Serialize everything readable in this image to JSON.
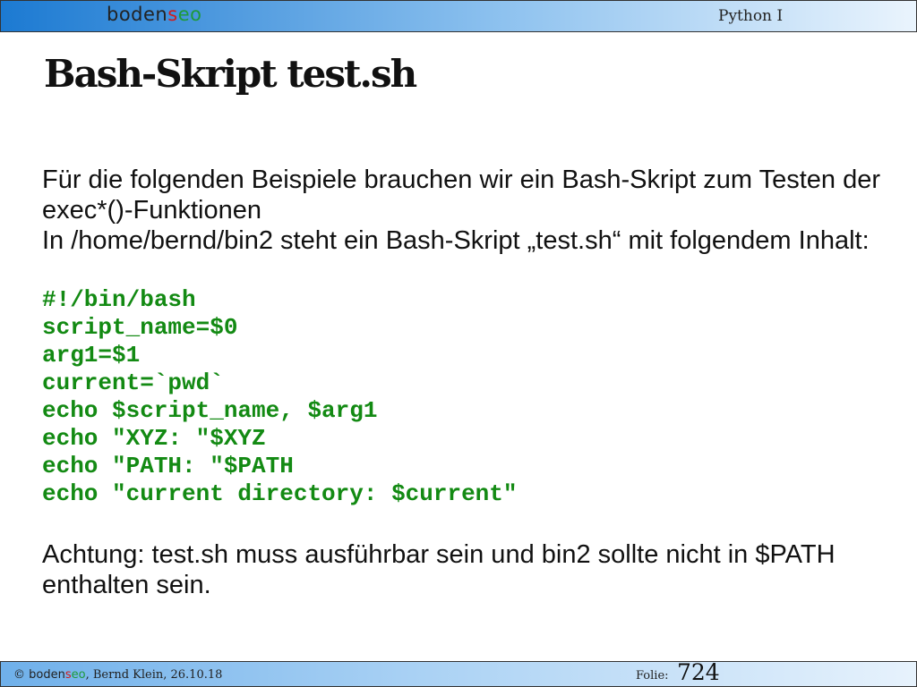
{
  "header": {
    "logo": {
      "part1": "boden",
      "part2": "s",
      "part3": "e",
      "part4": "o"
    },
    "course": "Python I"
  },
  "slide": {
    "title": "Bash-Skript test.sh",
    "intro_paragraphs": [
      "Für die folgenden Beispiele brauchen wir ein Bash-Skript zum Testen der exec*()-Funktionen",
      "In /home/bernd/bin2 steht ein Bash-Skript „test.sh“ mit folgendem Inhalt:"
    ],
    "code_lines": [
      "#!/bin/bash",
      "script_name=$0",
      "arg1=$1",
      "current=`pwd`",
      "echo $script_name, $arg1",
      "echo \"XYZ: \"$XYZ",
      "echo \"PATH: \"$PATH",
      "echo \"current directory: $current\""
    ],
    "note": "Achtung: test.sh muss ausführbar sein und bin2 sollte nicht in $PATH enthalten sein."
  },
  "footer": {
    "copyright_symbol": "©",
    "brand_part1": "boden",
    "brand_part2": "s",
    "brand_part3": "e",
    "brand_part4": "o",
    "author_date": ", Bernd Klein, 26.10.18",
    "folie_label": "Folie:",
    "folie_number": "724"
  },
  "colors": {
    "code": "#138a13",
    "header_gradient_start": "#1c7ad2",
    "logo_accent_red": "#d21a1a",
    "logo_accent_green": "#1e9a3a"
  }
}
